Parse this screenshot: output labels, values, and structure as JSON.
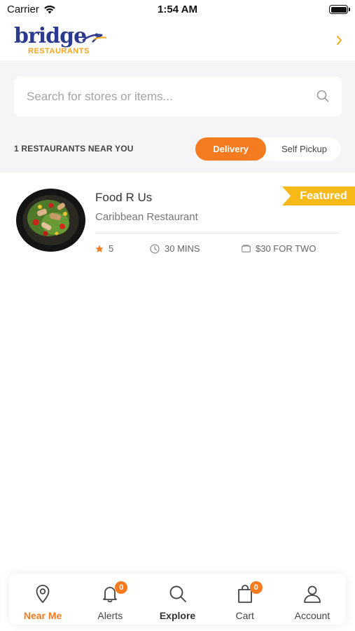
{
  "status_bar": {
    "carrier": "Carrier",
    "time": "1:54 AM"
  },
  "header": {
    "logo_text": "bridge",
    "logo_subtext": "RESTAURANTS",
    "chevron_icon": "chevron-right-icon"
  },
  "search": {
    "placeholder": "Search for stores or items...",
    "value": "",
    "icon": "search-icon"
  },
  "listing": {
    "count_label": "1 RESTAURANTS NEAR YOU",
    "mode_options": [
      "Delivery",
      "Self Pickup"
    ],
    "selected_mode": "Delivery"
  },
  "restaurants": [
    {
      "name": "Food R Us",
      "type": "Caribbean Restaurant",
      "badge": "Featured",
      "rating": "5",
      "time": "30 MINS",
      "price": "$30 FOR TWO"
    }
  ],
  "bottom_nav": {
    "items": [
      {
        "label": "Near Me",
        "icon": "location-pin-icon",
        "active": true
      },
      {
        "label": "Alerts",
        "icon": "bell-icon",
        "badge": "0"
      },
      {
        "label": "Explore",
        "icon": "search-icon"
      },
      {
        "label": "Cart",
        "icon": "shopping-bag-icon",
        "badge": "0"
      },
      {
        "label": "Account",
        "icon": "user-icon"
      }
    ]
  },
  "colors": {
    "accent": "#f47b20",
    "featured": "#f7b918",
    "brand_blue": "#2b3a8c",
    "background_gray": "#f5f5f7"
  }
}
